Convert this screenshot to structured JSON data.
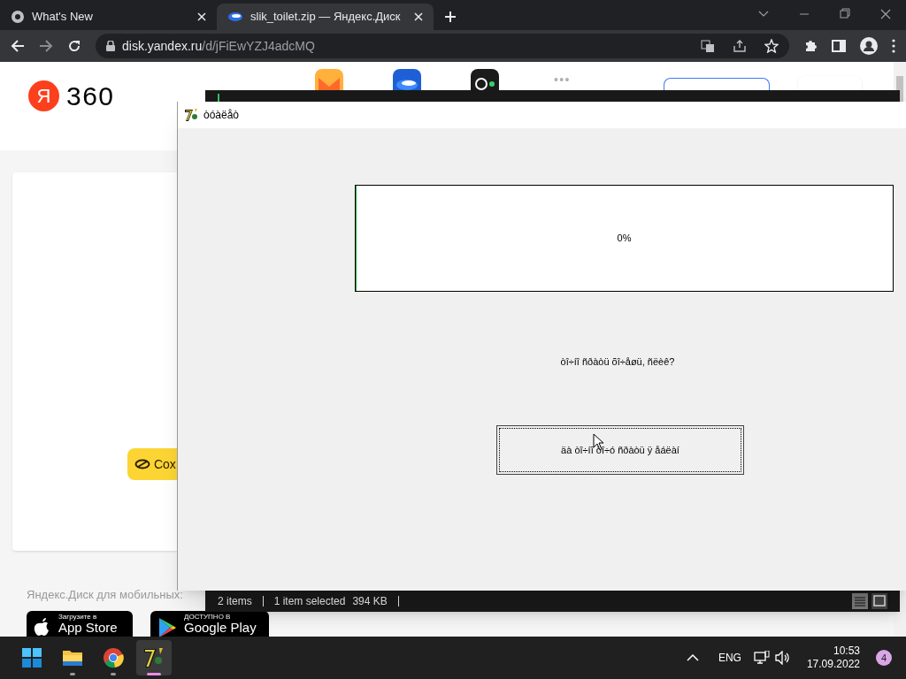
{
  "browser": {
    "tabs": [
      {
        "title": "What's New",
        "selected": false
      },
      {
        "title": "slik_toilet.zip — Яндекс.Диск",
        "selected": true
      }
    ],
    "address": {
      "host": "disk.yandex.ru",
      "path": "/d/jFiEwYZJ4adcMQ"
    }
  },
  "yandex_page": {
    "logo_letter": "Я",
    "logo_text": "360",
    "more": "•••",
    "save_button": "Сох",
    "mobile_label": "Яндекс.Диск для мобильных:",
    "store_badges": [
      {
        "kind": "apple",
        "small": "Загрузите в",
        "big": "App Store"
      },
      {
        "kind": "google",
        "small": "ДОСТУПНО В",
        "big": "Google Play"
      }
    ]
  },
  "file_manager": {
    "status_bar": {
      "items": "2 items",
      "selected": "1 item selected",
      "size": "394 KB"
    }
  },
  "dialog": {
    "title": "òóàëåò",
    "progress": {
      "level": 0,
      "label": "0%"
    },
    "question": "òî÷íî ñðàòü õî÷åøü, ñëèê?",
    "confirm_button": "äà òî÷íî õî÷ó ñðàòü ÿ åáëàí"
  },
  "taskbar": {
    "apps": [
      {
        "kind": "start",
        "running": false,
        "selected": false
      },
      {
        "kind": "folder",
        "running": true,
        "selected": false
      },
      {
        "kind": "chrome",
        "running": true,
        "selected": false
      },
      {
        "kind": "sevenzip",
        "running": true,
        "selected": true
      }
    ],
    "language": "ENG",
    "time": "10:53",
    "date": "17.09.2022",
    "notifications": "4"
  }
}
